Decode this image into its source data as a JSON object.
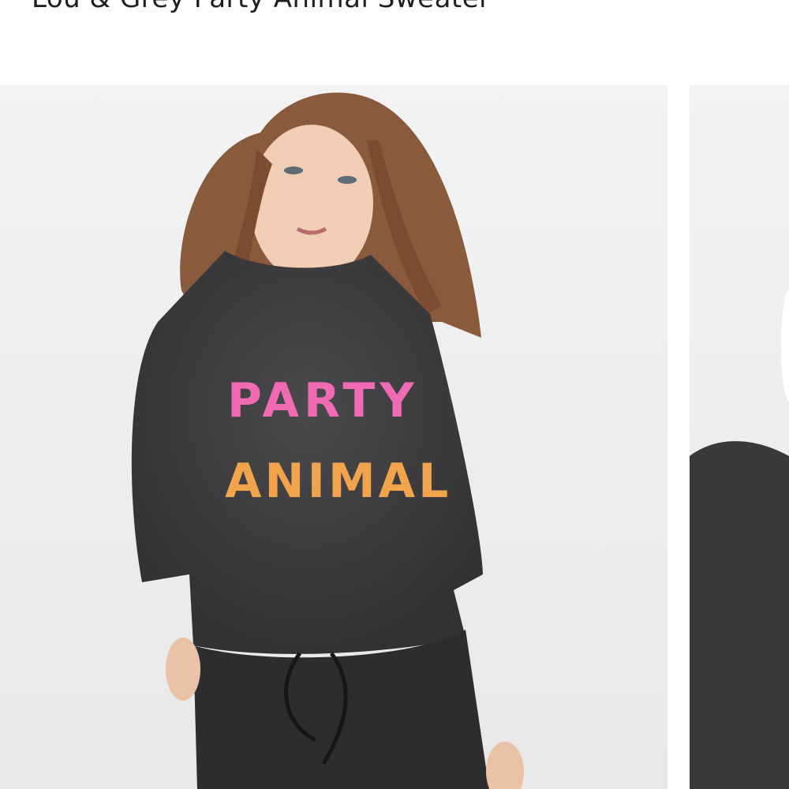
{
  "product": {
    "title": "Lou & Grey Party Animal Sweater"
  },
  "gallery": {
    "main_image_alt": "Model wearing grey Party Animal sweater",
    "next_image_alt": "Alternate view of sweater",
    "sweater_text_line1": "PARTY",
    "sweater_text_line2": "ANIMAL"
  },
  "colors": {
    "sweater": "#3b3b3d",
    "background": "#efefef",
    "title_text": "#1f1f1f"
  }
}
